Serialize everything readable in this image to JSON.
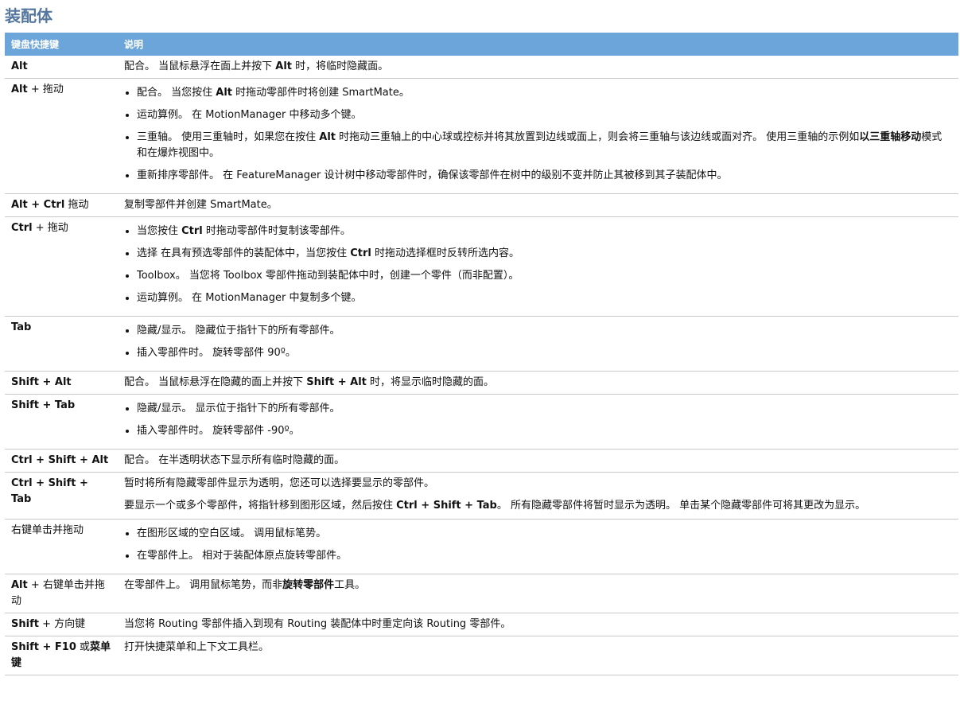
{
  "title": "装配体",
  "header": {
    "col_key": "键盘快捷键",
    "col_desc": "说明"
  },
  "rows": [
    {
      "key": [
        {
          "t": "Alt",
          "b": true
        }
      ],
      "type": "text",
      "desc": [
        {
          "t": "配合。 当鼠标悬浮在面上并按下 "
        },
        {
          "t": "Alt",
          "b": true
        },
        {
          "t": " 时，将临时隐藏面。"
        }
      ]
    },
    {
      "key": [
        {
          "t": "Alt",
          "b": true
        },
        {
          "t": " + 拖动"
        }
      ],
      "type": "list",
      "items": [
        [
          {
            "t": "配合。 当您按住 "
          },
          {
            "t": "Alt",
            "b": true
          },
          {
            "t": " 时拖动零部件时将创建 SmartMate。"
          }
        ],
        [
          {
            "t": "运动算例。 在 MotionManager 中移动多个键。"
          }
        ],
        [
          {
            "t": "三重轴。 使用三重轴时，如果您在按住 "
          },
          {
            "t": "Alt",
            "b": true
          },
          {
            "t": " 时拖动三重轴上的中心球或控标并将其放置到边线或面上，则会将三重轴与该边线或面对齐。 使用三重轴的示例如"
          },
          {
            "t": "以三重轴移动",
            "b": true
          },
          {
            "t": "模式和在爆炸视图中。"
          }
        ],
        [
          {
            "t": "重新排序零部件。 在 FeatureManager 设计树中移动零部件时，确保该零部件在树中的级别不变并防止其被移到其子装配体中。"
          }
        ]
      ]
    },
    {
      "key": [
        {
          "t": "Alt + Ctrl",
          "b": true
        },
        {
          "t": " 拖动"
        }
      ],
      "type": "text",
      "desc": [
        {
          "t": "复制零部件并创建 SmartMate。"
        }
      ]
    },
    {
      "key": [
        {
          "t": "Ctrl",
          "b": true
        },
        {
          "t": " + 拖动"
        }
      ],
      "type": "list",
      "items": [
        [
          {
            "t": "当您按住 "
          },
          {
            "t": "Ctrl",
            "b": true
          },
          {
            "t": " 时拖动零部件时复制该零部件。"
          }
        ],
        [
          {
            "t": "选择 在具有预选零部件的装配体中，当您按住 "
          },
          {
            "t": "Ctrl",
            "b": true
          },
          {
            "t": " 时拖动选择框时反转所选内容。"
          }
        ],
        [
          {
            "t": "Toolbox。 当您将 Toolbox 零部件拖动到装配体中时，创建一个零件（而非配置）。"
          }
        ],
        [
          {
            "t": "运动算例。 在 MotionManager 中复制多个键。"
          }
        ]
      ]
    },
    {
      "key": [
        {
          "t": "Tab",
          "b": true
        }
      ],
      "type": "list",
      "items": [
        [
          {
            "t": "隐藏/显示。 隐藏位于指针下的所有零部件。"
          }
        ],
        [
          {
            "t": "插入零部件时。 旋转零部件 90º。"
          }
        ]
      ]
    },
    {
      "key": [
        {
          "t": "Shift + Alt",
          "b": true
        }
      ],
      "type": "text",
      "desc": [
        {
          "t": "配合。 当鼠标悬浮在隐藏的面上并按下 "
        },
        {
          "t": "Shift + Alt",
          "b": true
        },
        {
          "t": " 时，将显示临时隐藏的面。"
        }
      ]
    },
    {
      "key": [
        {
          "t": "Shift + Tab",
          "b": true
        }
      ],
      "type": "list",
      "items": [
        [
          {
            "t": "隐藏/显示。 显示位于指针下的所有零部件。"
          }
        ],
        [
          {
            "t": "插入零部件时。 旋转零部件 -90º。"
          }
        ]
      ]
    },
    {
      "key": [
        {
          "t": "Ctrl + Shift + Alt",
          "b": true
        }
      ],
      "type": "text",
      "desc": [
        {
          "t": "配合。 在半透明状态下显示所有临时隐藏的面。"
        }
      ]
    },
    {
      "key": [
        {
          "t": "Ctrl + Shift + Tab",
          "b": true
        }
      ],
      "type": "paras",
      "paras": [
        [
          {
            "t": "暂时将所有隐藏零部件显示为透明，您还可以选择要显示的零部件。"
          }
        ],
        [
          {
            "t": "要显示一个或多个零部件，将指针移到图形区域，然后按住 "
          },
          {
            "t": "Ctrl + Shift + Tab",
            "b": true
          },
          {
            "t": "。 所有隐藏零部件将暂时显示为透明。 单击某个隐藏零部件可将其更改为显示。"
          }
        ]
      ]
    },
    {
      "key": [
        {
          "t": "右键单击并拖动"
        }
      ],
      "type": "list",
      "items": [
        [
          {
            "t": "在图形区域的空白区域。 调用鼠标笔势。"
          }
        ],
        [
          {
            "t": "在零部件上。 相对于装配体原点旋转零部件。"
          }
        ]
      ]
    },
    {
      "key": [
        {
          "t": "Alt",
          "b": true
        },
        {
          "t": " + 右键单击并拖动"
        }
      ],
      "type": "text",
      "desc": [
        {
          "t": "在零部件上。 调用鼠标笔势，而非"
        },
        {
          "t": "旋转零部件",
          "b": true
        },
        {
          "t": "工具。"
        }
      ]
    },
    {
      "key": [
        {
          "t": "Shift",
          "b": true
        },
        {
          "t": " + 方向键"
        }
      ],
      "type": "text",
      "desc": [
        {
          "t": "当您将 Routing 零部件插入到现有 Routing 装配体中时重定向该 Routing 零部件。"
        }
      ]
    },
    {
      "key": [
        {
          "t": "Shift + F10",
          "b": true
        },
        {
          "t": " 或"
        },
        {
          "t": "菜单键",
          "b": true
        }
      ],
      "type": "text",
      "desc": [
        {
          "t": "打开快捷菜单和上下文工具栏。"
        }
      ]
    }
  ]
}
